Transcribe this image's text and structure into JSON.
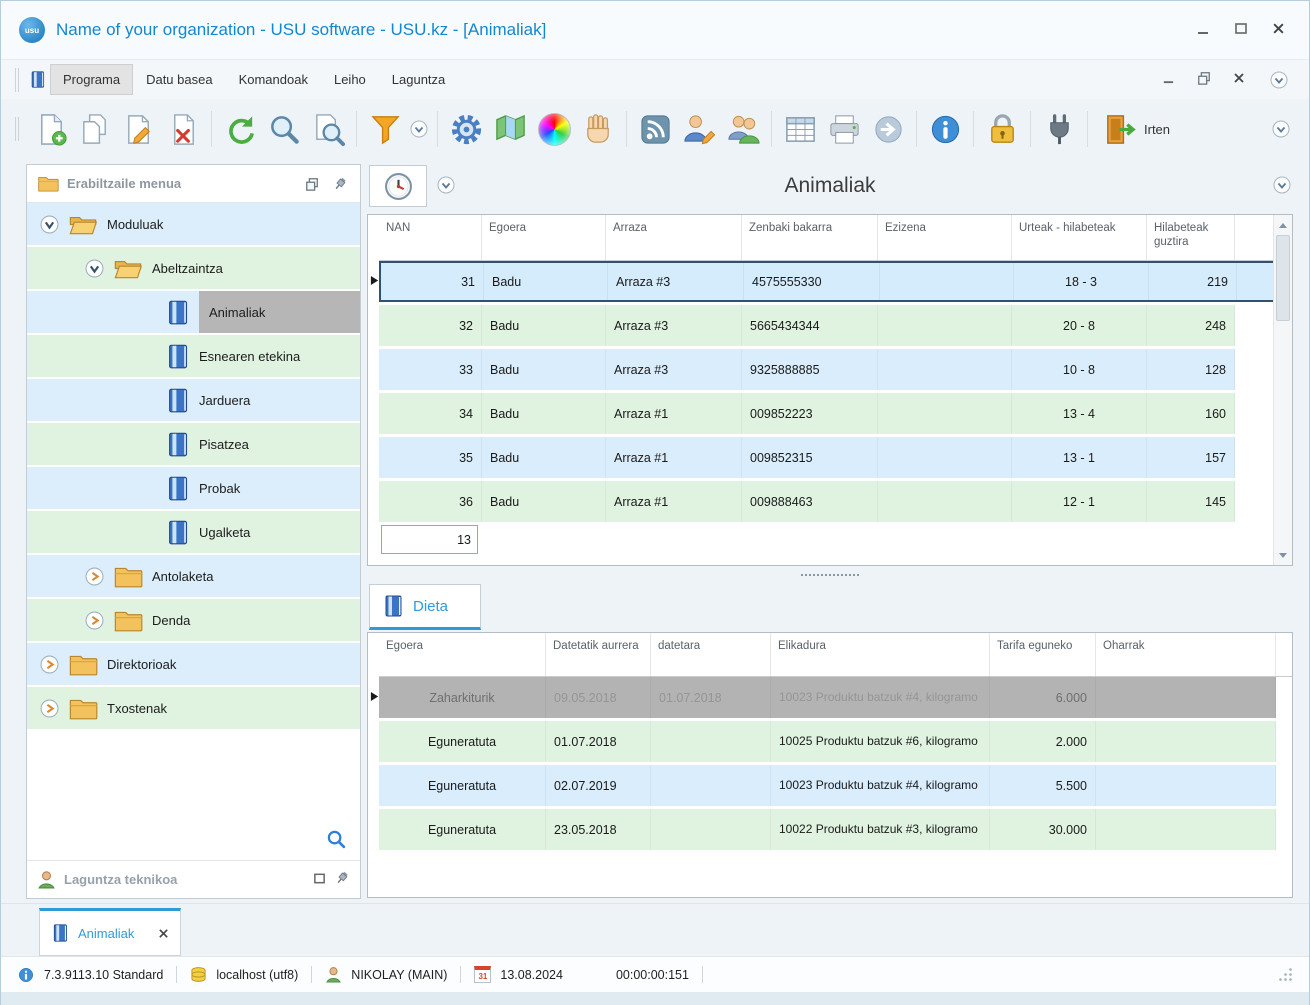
{
  "window": {
    "title": "Name of your organization - USU software - USU.kz - [Animaliak]",
    "logo_text": "usu"
  },
  "menubar": {
    "items": [
      {
        "label": "Programa"
      },
      {
        "label": "Datu basea"
      },
      {
        "label": "Komandoak"
      },
      {
        "label": "Leiho"
      },
      {
        "label": "Laguntza"
      }
    ]
  },
  "toolbar": {
    "exit_label": "Irten"
  },
  "sidebar": {
    "header": "Erabiltzaile menua",
    "support_header": "Laguntza teknikoa",
    "tree": [
      {
        "label": "Moduluak",
        "type": "folder",
        "state": "expanded"
      },
      {
        "label": "Abeltzaintza",
        "type": "folder",
        "state": "expanded"
      },
      {
        "label": "Animaliak",
        "type": "module",
        "selected": true
      },
      {
        "label": "Esnearen etekina",
        "type": "module"
      },
      {
        "label": "Jarduera",
        "type": "module"
      },
      {
        "label": "Pisatzea",
        "type": "module"
      },
      {
        "label": "Probak",
        "type": "module"
      },
      {
        "label": "Ugalketa",
        "type": "module"
      },
      {
        "label": "Antolaketa",
        "type": "folder",
        "state": "collapsed"
      },
      {
        "label": "Denda",
        "type": "folder",
        "state": "collapsed"
      },
      {
        "label": "Direktorioak",
        "type": "folder",
        "state": "collapsed"
      },
      {
        "label": "Txostenak",
        "type": "folder",
        "state": "collapsed"
      }
    ]
  },
  "main": {
    "title": "Animaliak",
    "animals_table": {
      "columns": [
        "NAN",
        "Egoera",
        "Arraza",
        "Zenbaki bakarra",
        "Ezizena",
        "Urteak - hilabeteak",
        "Hilabeteak guztira"
      ],
      "rows": [
        {
          "nan": "31",
          "egoera": "Badu",
          "arraza": "Arraza #3",
          "zenbaki": "4575555330",
          "ezizena": "",
          "urteak": "18 - 3",
          "hilabeteak": "219"
        },
        {
          "nan": "32",
          "egoera": "Badu",
          "arraza": "Arraza #3",
          "zenbaki": "5665434344",
          "ezizena": "",
          "urteak": "20 - 8",
          "hilabeteak": "248"
        },
        {
          "nan": "33",
          "egoera": "Badu",
          "arraza": "Arraza #3",
          "zenbaki": "9325888885",
          "ezizena": "",
          "urteak": "10 - 8",
          "hilabeteak": "128"
        },
        {
          "nan": "34",
          "egoera": "Badu",
          "arraza": "Arraza #1",
          "zenbaki": "009852223",
          "ezizena": "",
          "urteak": "13 - 4",
          "hilabeteak": "160"
        },
        {
          "nan": "35",
          "egoera": "Badu",
          "arraza": "Arraza #1",
          "zenbaki": "009852315",
          "ezizena": "",
          "urteak": "13 - 1",
          "hilabeteak": "157"
        },
        {
          "nan": "36",
          "egoera": "Badu",
          "arraza": "Arraza #1",
          "zenbaki": "009888463",
          "ezizena": "",
          "urteak": "12 - 1",
          "hilabeteak": "145"
        }
      ],
      "filter_value": "13"
    },
    "dieta": {
      "tab_label": "Dieta",
      "columns": [
        "Egoera",
        "Datetatik aurrera",
        "datetara",
        "Elikadura",
        "Tarifa eguneko",
        "Oharrak"
      ],
      "rows": [
        {
          "egoera": "Zaharkiturik",
          "datetatik": "09.05.2018",
          "datetara": "01.07.2018",
          "elikadura": "10023 Produktu batzuk #4, kilogramo",
          "tarifa": "6.000",
          "oharrak": ""
        },
        {
          "egoera": "Eguneratuta",
          "datetatik": "01.07.2018",
          "datetara": "",
          "elikadura": "10025 Produktu batzuk #6, kilogramo",
          "tarifa": "2.000",
          "oharrak": ""
        },
        {
          "egoera": "Eguneratuta",
          "datetatik": "02.07.2019",
          "datetara": "",
          "elikadura": "10023 Produktu batzuk #4, kilogramo",
          "tarifa": "5.500",
          "oharrak": ""
        },
        {
          "egoera": "Eguneratuta",
          "datetatik": "23.05.2018",
          "datetara": "",
          "elikadura": "10022 Produktu batzuk #3, kilogramo",
          "tarifa": "30.000",
          "oharrak": ""
        }
      ]
    }
  },
  "bottom_tabs": {
    "tabs": [
      {
        "label": "Animaliak"
      }
    ]
  },
  "statusbar": {
    "version": "7.3.9113.10 Standard",
    "database": "localhost (utf8)",
    "user": "NIKOLAY (MAIN)",
    "calendar_day": "31",
    "date": "13.08.2024",
    "timer": "00:00:00:151"
  }
}
